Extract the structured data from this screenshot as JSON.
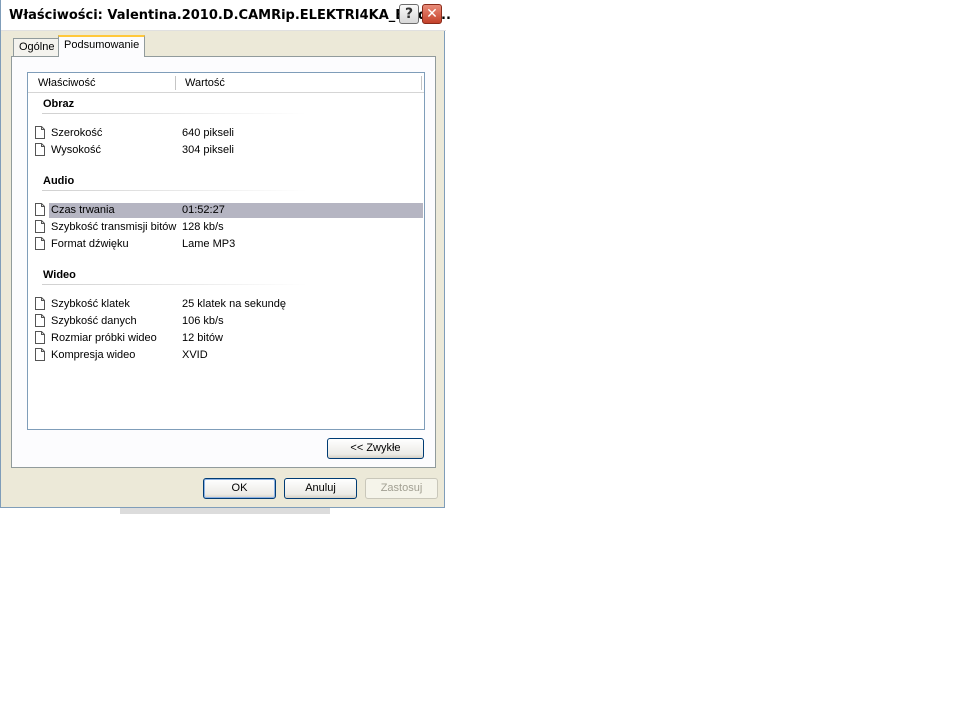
{
  "window": {
    "title": "Właściwości: Valentina.2010.D.CAMRip.ELEKTRI4KA_Epide...",
    "help_glyph": "?",
    "close_glyph": "✕"
  },
  "tabs": [
    {
      "label": "Ogólne",
      "active": false
    },
    {
      "label": "Podsumowanie",
      "active": true
    }
  ],
  "list": {
    "columns": [
      "Właściwość",
      "Wartość"
    ],
    "groups": [
      {
        "title": "Obraz",
        "rows": [
          {
            "property": "Szerokość",
            "value": "640 pikseli"
          },
          {
            "property": "Wysokość",
            "value": "304 pikseli"
          }
        ]
      },
      {
        "title": "Audio",
        "rows": [
          {
            "property": "Czas trwania",
            "value": "01:52:27",
            "selected": true
          },
          {
            "property": "Szybkość transmisji bitów",
            "value": "128 kb/s"
          },
          {
            "property": "Format dźwięku",
            "value": "Lame MP3"
          }
        ]
      },
      {
        "title": "Wideo",
        "rows": [
          {
            "property": "Szybkość klatek",
            "value": "25 klatek na sekundę"
          },
          {
            "property": "Szybkość danych",
            "value": "106 kb/s"
          },
          {
            "property": "Rozmiar próbki wideo",
            "value": "12 bitów"
          },
          {
            "property": "Kompresja wideo",
            "value": "XVID"
          }
        ]
      }
    ]
  },
  "buttons": {
    "simple": "<< Zwykłe",
    "ok": "OK",
    "cancel": "Anuluj",
    "apply": "Zastosuj"
  },
  "colors": {
    "selection": "#b5b5c2",
    "dialog_face": "#ece9d8",
    "tab_highlight": "#ffc83c"
  }
}
